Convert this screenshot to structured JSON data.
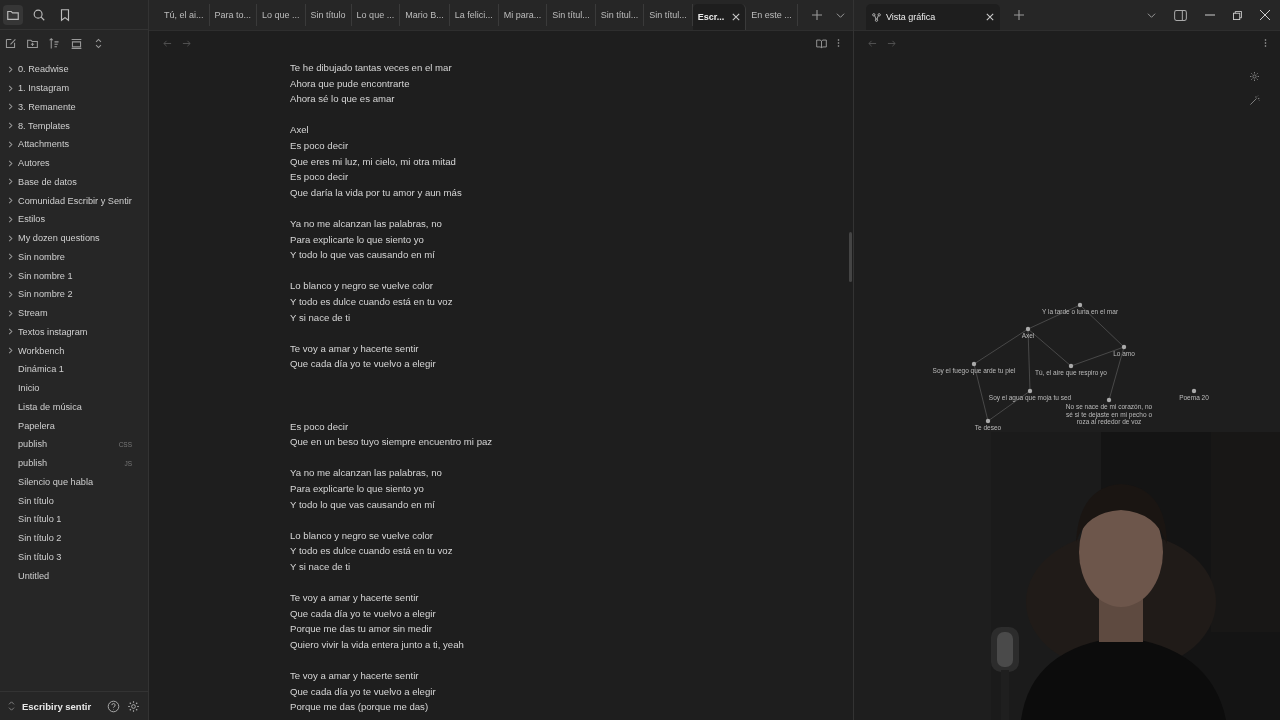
{
  "sidebar_tabs": [
    {
      "kind": "files",
      "selected": true
    },
    {
      "kind": "search",
      "selected": false
    },
    {
      "kind": "bookmarks",
      "selected": false
    }
  ],
  "file_tree": [
    {
      "label": "0. Readwise",
      "kind": "folder",
      "expanded": false
    },
    {
      "label": "1. Instagram",
      "kind": "folder",
      "expanded": false
    },
    {
      "label": "3. Remanente",
      "kind": "folder",
      "expanded": false
    },
    {
      "label": "8. Templates",
      "kind": "folder",
      "expanded": false
    },
    {
      "label": "Attachments",
      "kind": "folder",
      "expanded": false
    },
    {
      "label": "Autores",
      "kind": "folder",
      "expanded": false
    },
    {
      "label": "Base de datos",
      "kind": "folder",
      "expanded": false
    },
    {
      "label": "Comunidad Escribir y Sentir",
      "kind": "folder",
      "expanded": false
    },
    {
      "label": "Estilos",
      "kind": "folder",
      "expanded": false
    },
    {
      "label": "My dozen questions",
      "kind": "folder",
      "expanded": false
    },
    {
      "label": "Sin nombre",
      "kind": "folder",
      "expanded": false
    },
    {
      "label": "Sin nombre 1",
      "kind": "folder",
      "expanded": false
    },
    {
      "label": "Sin nombre 2",
      "kind": "folder",
      "expanded": false
    },
    {
      "label": "Stream",
      "kind": "folder",
      "expanded": false
    },
    {
      "label": "Textos instagram",
      "kind": "folder",
      "expanded": false
    },
    {
      "label": "Workbench",
      "kind": "folder",
      "expanded": false
    },
    {
      "label": "Dinámica 1",
      "kind": "file"
    },
    {
      "label": "Inicio",
      "kind": "file"
    },
    {
      "label": "Lista de música",
      "kind": "file"
    },
    {
      "label": "Papelera",
      "kind": "file"
    },
    {
      "label": "publish",
      "kind": "file",
      "extension": "CSS"
    },
    {
      "label": "publish",
      "kind": "file",
      "extension": "JS"
    },
    {
      "label": "Silencio que habla",
      "kind": "file"
    },
    {
      "label": "Sin título",
      "kind": "file"
    },
    {
      "label": "Sin título 1",
      "kind": "file"
    },
    {
      "label": "Sin título 2",
      "kind": "file"
    },
    {
      "label": "Sin título 3",
      "kind": "file"
    },
    {
      "label": "Untitled",
      "kind": "file"
    }
  ],
  "vault": {
    "name": "Escribiry sentir"
  },
  "tabs": [
    {
      "label": "Tú, el ai...",
      "selected": false
    },
    {
      "label": "Para to...",
      "selected": false
    },
    {
      "label": "Lo que ...",
      "selected": false
    },
    {
      "label": "Sin título",
      "selected": false
    },
    {
      "label": "Lo que ...",
      "selected": false
    },
    {
      "label": "Mario B...",
      "selected": false
    },
    {
      "label": "La felici...",
      "selected": false
    },
    {
      "label": "Mi para...",
      "selected": false
    },
    {
      "label": "Sin títul...",
      "selected": false
    },
    {
      "label": "Sin títul...",
      "selected": false
    },
    {
      "label": "Sin títul...",
      "selected": false
    },
    {
      "label": "Escr...",
      "selected": true
    },
    {
      "label": "En este ...",
      "selected": false
    }
  ],
  "graph_tab": {
    "label": "Vista gráfica",
    "selected": true
  },
  "note": {
    "parts": [
      {
        "stanzas": [
          {
            "lines": [
              "Te he dibujado tantas veces en el mar",
              "Ahora que pude encontrarte",
              "Ahora sé lo que es amar"
            ]
          },
          {
            "lines": [
              "Axel",
              "Es poco decir",
              "Que eres mi luz, mi cielo, mi otra mitad",
              "Es poco decir",
              "Que daría la vida por tu amor y aun más"
            ]
          },
          {
            "lines": [
              "Ya no me alcanzan las palabras, no",
              "Para explicarte lo que siento yo",
              "Y todo lo que vas causando en mí"
            ]
          },
          {
            "lines": [
              "Lo blanco y negro se vuelve color",
              "Y todo es dulce cuando está en tu voz",
              "Y si nace de ti"
            ]
          },
          {
            "lines": [
              "Te voy a amar y hacerte sentir",
              "Que cada día yo te vuelvo a elegir"
            ]
          }
        ]
      },
      {
        "stanzas": [
          {
            "lines": [
              "Es poco decir",
              "Que en un beso tuyo siempre encuentro mi paz"
            ]
          },
          {
            "lines": [
              "Ya no me alcanzan las palabras, no",
              "Para explicarte lo que siento yo",
              "Y todo lo que vas causando en mí"
            ]
          },
          {
            "lines": [
              "Lo blanco y negro se vuelve color",
              "Y todo es dulce cuando está en tu voz",
              "Y si nace de ti"
            ]
          },
          {
            "lines": [
              "Te voy a amar y hacerte sentir",
              "Que cada día yo te vuelvo a elegir",
              "Porque me das tu amor sin medir",
              "Quiero vivir la vida entera junto a ti, yeah"
            ]
          },
          {
            "lines": [
              "Te voy a amar y hacerte sentir",
              "Que cada día yo te vuelvo a elegir",
              "Porque me das (porque me das)"
            ]
          }
        ]
      }
    ]
  },
  "graph": {
    "nodes": [
      {
        "label": "Y la tarde o luna en el mar"
      },
      {
        "label": "Axel"
      },
      {
        "label": "Lo amo"
      },
      {
        "label": "Soy el fuego que arde tu piel"
      },
      {
        "label": "Tú, el aire que respiro yo"
      },
      {
        "label": "Soy el agua que moja tu sed"
      },
      {
        "label": "Poema 20"
      },
      {
        "label": "No se nace de mi corazón, no sé si te dejaste en mi pecho o roza al rededor de voz"
      },
      {
        "label": "Te deseo"
      }
    ]
  }
}
